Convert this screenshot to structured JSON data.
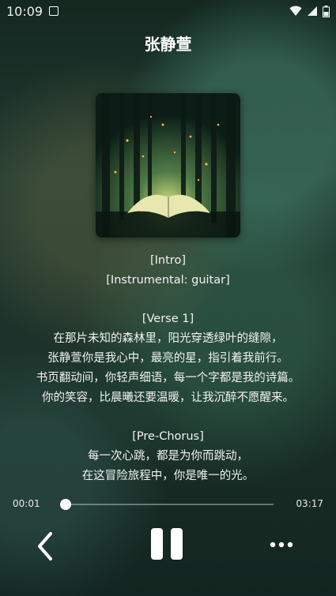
{
  "status_bar": {
    "time": "10:09",
    "icons": [
      "notification-icon",
      "wifi-icon",
      "signal-icon",
      "battery-icon"
    ]
  },
  "song": {
    "title": "张静萱"
  },
  "lyrics": [
    "[Intro]",
    "[Instrumental: guitar]",
    "",
    "[Verse 1]",
    "在那片未知的森林里，阳光穿透绿叶的缝隙，",
    "张静萱你是我心中，最亮的星，指引着我前行。",
    "书页翻动间，你轻声细语，每一个字都是我的诗篇。",
    "你的笑容，比晨曦还要温暖，让我沉醉不愿醒来。",
    "",
    "[Pre-Chorus]",
    "每一次心跳，都是为你而跳动，",
    "在这冒险旅程中，你是唯一的光。"
  ],
  "player": {
    "current_time": "00:01",
    "total_time": "03:17",
    "progress": 0.01
  },
  "controls": {
    "back_icon": "chevron-left-icon",
    "pause_icon": "pause-icon",
    "more_icon": "more-horizontal-icon"
  },
  "colors": {
    "background_dark": "#142820",
    "background_mid": "#213a31",
    "text": "#ffffff"
  }
}
